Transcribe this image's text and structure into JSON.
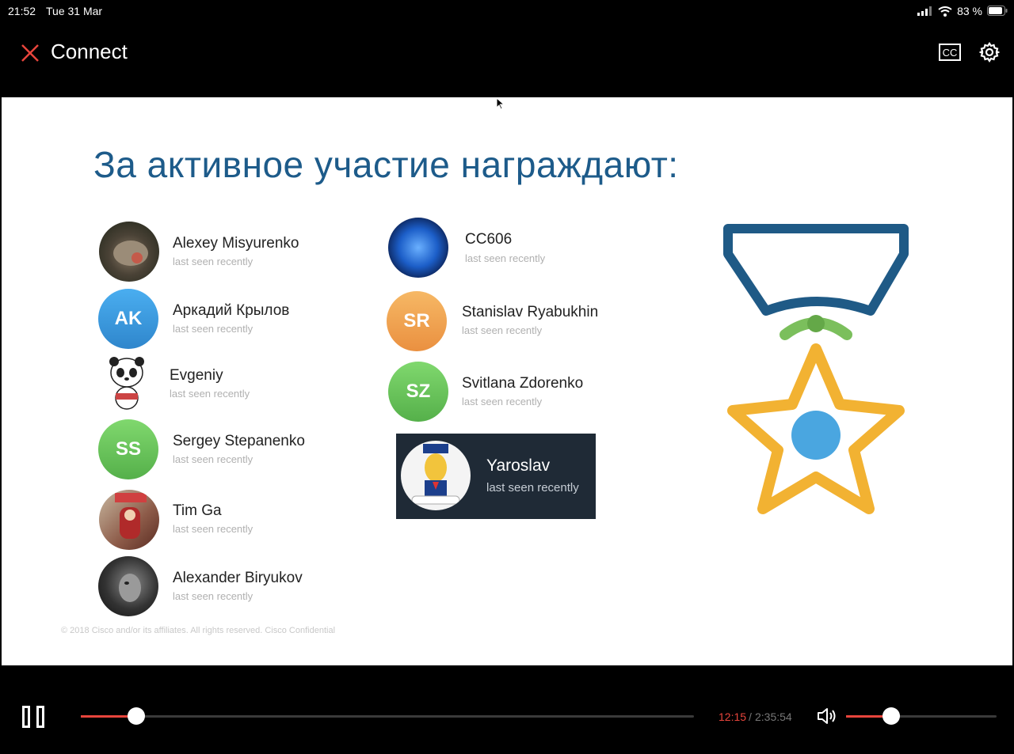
{
  "status_bar": {
    "time": "21:52",
    "date": "Tue 31 Mar",
    "battery": "83 %"
  },
  "app": {
    "title": "Connect",
    "close_icon": "close-icon",
    "cc_label": "CC",
    "settings_icon": "gear-icon"
  },
  "slide": {
    "title": "За активное участие награждают:",
    "members": [
      {
        "name": "Alexey Misyurenko",
        "status": "last seen recently"
      },
      {
        "name": "Аркадий Крылов",
        "status": "last seen recently",
        "initials": "AK",
        "color": "#3a9bdc"
      },
      {
        "name": "Evgeniy",
        "status": "last seen recently"
      },
      {
        "name": "Sergey Stepanenko",
        "status": "last seen recently",
        "initials": "SS",
        "color": "#6cc160"
      },
      {
        "name": "Tim Ga",
        "status": "last seen recently"
      },
      {
        "name": "Alexander Biryukov",
        "status": "last seen recently"
      },
      {
        "name": "CC606",
        "status": "last seen recently"
      },
      {
        "name": "Stanislav Ryabukhin",
        "status": "last seen recently",
        "initials": "SR",
        "color": "#f0a044"
      },
      {
        "name": "Svitlana Zdorenko",
        "status": "last seen recently",
        "initials": "SZ",
        "color": "#6cc160"
      },
      {
        "name": "Yaroslav",
        "status": "last seen recently"
      }
    ],
    "copyright": "© 2018  Cisco and/or its affiliates. All rights reserved.   Cisco Confidential",
    "medal_icon": "medal-star-icon"
  },
  "player": {
    "current_time": "12:15",
    "separator": "/",
    "total_time": "2:35:54",
    "progress": 0.09,
    "volume": 0.3,
    "accent_color": "#e8453c"
  }
}
